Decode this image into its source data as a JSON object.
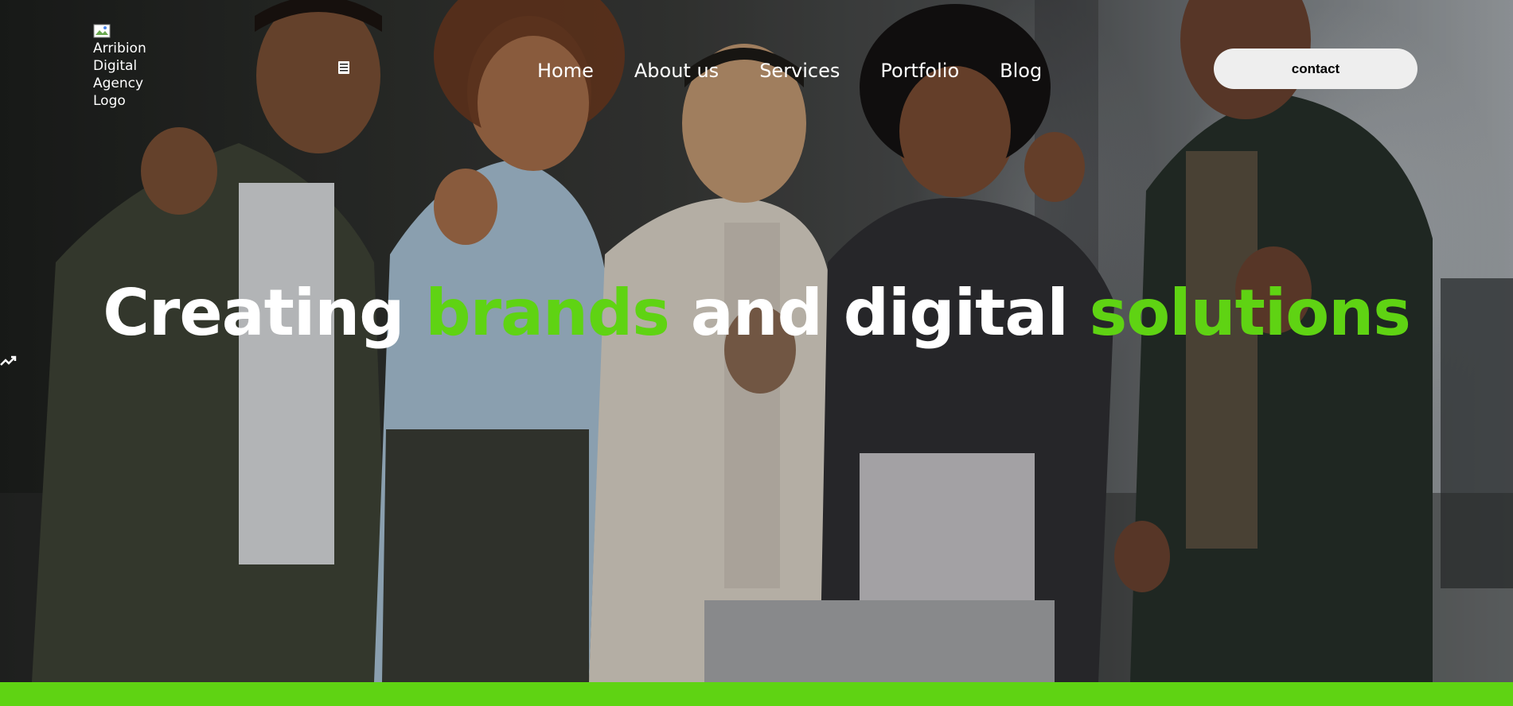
{
  "logo": {
    "alt_text": "Arribion Digital Agency Logo"
  },
  "nav": {
    "items": [
      {
        "label": "Home"
      },
      {
        "label": "About us"
      },
      {
        "label": "Services"
      },
      {
        "label": "Portfolio"
      },
      {
        "label": "Blog"
      }
    ]
  },
  "header": {
    "contact_label": "contact"
  },
  "hero": {
    "headline": {
      "part1": "Creating ",
      "accent1": "brands",
      "part2": " and digital ",
      "accent2": "solutions"
    }
  },
  "icons": {
    "menu": "menu-icon",
    "side": "trending-up-icon",
    "logo": "broken-image-icon"
  },
  "colors": {
    "accent": "#5fd313",
    "text": "#ffffff",
    "button_bg": "#eeeeee",
    "button_text": "#000000"
  }
}
